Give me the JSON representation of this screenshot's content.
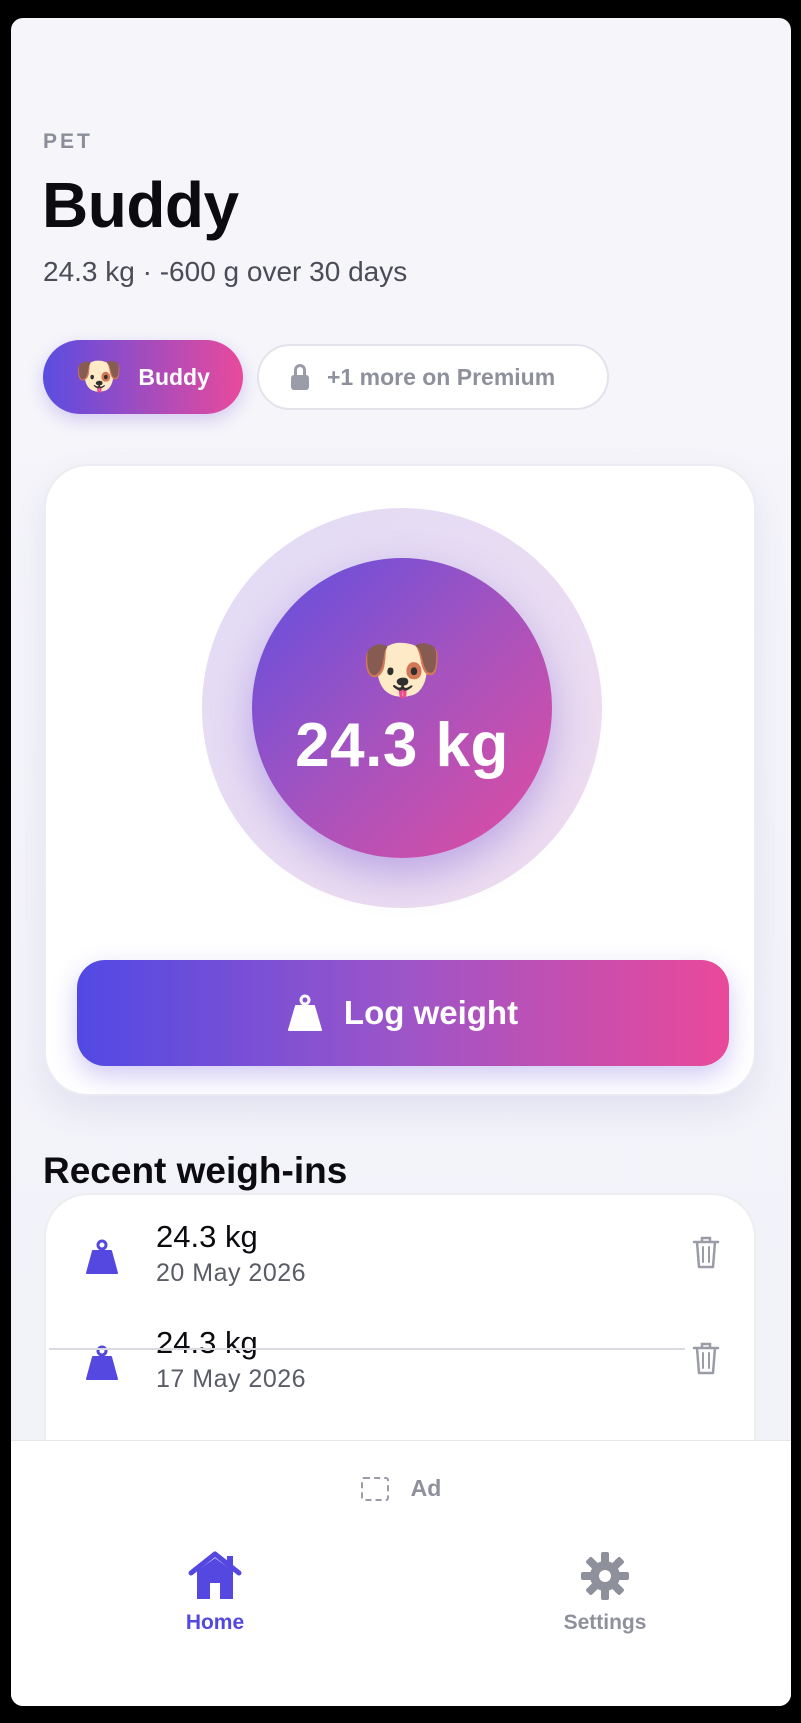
{
  "header": {
    "eyebrow": "PET",
    "title": "Buddy",
    "subtitle": "24.3 kg · -600 g over 30 days"
  },
  "pet_chips": {
    "active": {
      "emoji": "🐶",
      "label": "Buddy"
    },
    "locked": {
      "label": "+1 more on Premium",
      "icon": "lock-icon"
    }
  },
  "hero": {
    "emoji": "🐶",
    "weight": "24.3 kg",
    "button_label": "Log weight",
    "button_icon": "weight-icon"
  },
  "recent": {
    "title": "Recent weigh-ins",
    "items": [
      {
        "weight": "24.3 kg",
        "date": "20 May 2026"
      },
      {
        "weight": "24.3 kg",
        "date": "17 May 2026"
      }
    ]
  },
  "ad": {
    "label": "Ad"
  },
  "tabs": [
    {
      "label": "Home",
      "icon": "home-icon",
      "active": true
    },
    {
      "label": "Settings",
      "icon": "gear-icon",
      "active": false
    }
  ],
  "colors": {
    "accent": "#5548e0",
    "gradient_start": "#5149e4",
    "gradient_end": "#ea4999",
    "muted": "#8e909c"
  }
}
